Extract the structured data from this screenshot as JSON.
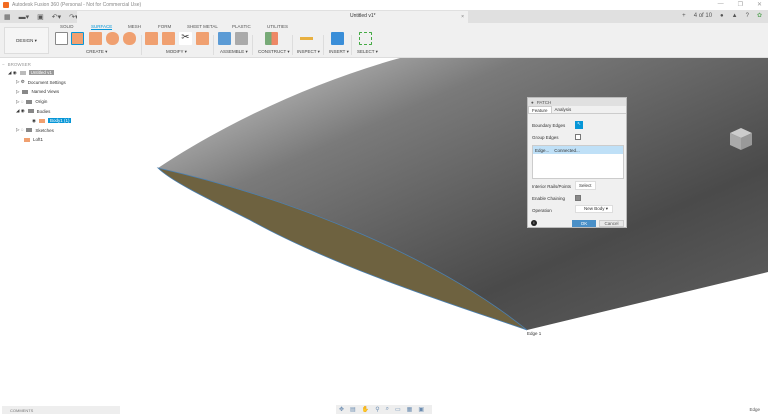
{
  "app": {
    "title": "Autodesk Fusion 360 (Personal - Not for Commercial Use)",
    "window_controls": [
      "—",
      "❐",
      "✕"
    ]
  },
  "document": {
    "title": "Untitled v1*",
    "close": "×",
    "add": "+",
    "job_status": "4 of 10"
  },
  "ribbon": {
    "workspace": "DESIGN ▾",
    "tabs": [
      "SOLID",
      "SURFACE",
      "MESH",
      "FORM",
      "SHEET METAL",
      "PLASTIC",
      "UTILITIES"
    ],
    "active_tab": "SURFACE",
    "groups": [
      "CREATE ▾",
      "MODIFY ▾",
      "ASSEMBLE ▾",
      "CONSTRUCT ▾",
      "INSPECT ▾",
      "INSERT ▾",
      "SELECT ▾"
    ]
  },
  "browser": {
    "title": "BROWSER",
    "items": [
      "Untitled v1",
      "Document Settings",
      "Named Views",
      "Origin",
      "Bodies",
      "Body1 (1)",
      "Sketches",
      "Loft1"
    ]
  },
  "patch": {
    "title": "PATCH",
    "tabs": [
      "Feature",
      "Analysis"
    ],
    "boundary_edges": "Boundary Edges",
    "group_edges": "Group Edges",
    "edge_col": "Edge...",
    "edge_val": "Connected...",
    "interior": "Interior Rails/Points",
    "select": "Select",
    "chaining": "Enable Chaining",
    "operation": "Operation",
    "op_val": "New Body",
    "ok": "OK",
    "cancel": "Cancel",
    "info": "i"
  },
  "viewport": {
    "edge_label": "Edge 1"
  },
  "bottom": {
    "comments": "COMMENTS",
    "status": "Edge"
  },
  "colors": {
    "accent": "#0696d7",
    "orange": "#f0a070"
  }
}
